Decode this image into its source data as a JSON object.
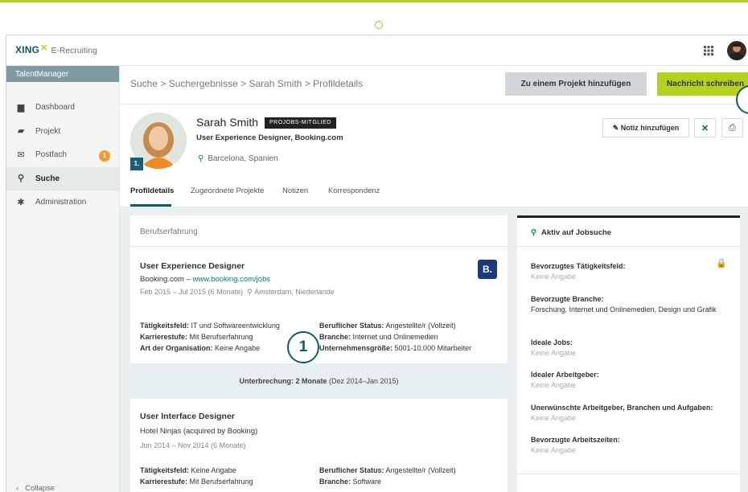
{
  "app": {
    "brand": "XING",
    "product": "E-Recruiting",
    "section": "TalentManager"
  },
  "nav": [
    {
      "label": "Dashboard",
      "icon": "dashboard-icon"
    },
    {
      "label": "Projekt",
      "icon": "folder-icon"
    },
    {
      "label": "Postfach",
      "icon": "mail-icon",
      "badge": "1"
    },
    {
      "label": "Suche",
      "icon": "search-icon",
      "active": true
    },
    {
      "label": "Administration",
      "icon": "gear-icon"
    }
  ],
  "collapse_label": "Collapse",
  "breadcrumb": "Suche > Suchergebnisse > Sarah Smith > Profildetails",
  "actions": {
    "add_project": "Zu einem Projekt hinzufügen",
    "message": "Nachricht schreiben",
    "note": "Notiz hinzufügen"
  },
  "profile": {
    "name": "Sarah Smith",
    "badge": "PROJOBS-MITGLIED",
    "headline": "User Experience Designer, Booking.com",
    "location": "Barcelona, Spanien",
    "rank": "1."
  },
  "tabs": [
    "Profildetails",
    "Zugeordnete Projekte",
    "Notizen",
    "Korrespondenz"
  ],
  "experience": {
    "section_title": "Berufserfahrung",
    "jobs": [
      {
        "title": "User Experience Designer",
        "company": "Booking.com",
        "sep": " – ",
        "link": "www.booking.com/jobs",
        "dates": "Feb 2015 – Jul 2015 (6 Monate)",
        "location": "Amsterdam, Niederlande",
        "logo": "B.",
        "left": [
          [
            "Tätigkeitsfeld:",
            "IT und Softwareentwicklung"
          ],
          [
            "Karrierestufe:",
            "Mit Berufserfahrung"
          ],
          [
            "Art der Organisation:",
            "Keine Angabe"
          ]
        ],
        "right": [
          [
            "Beruflicher Status:",
            "Angestellte/r (Vollzeit)"
          ],
          [
            "Branche:",
            "Internet und Onlinemedien"
          ],
          [
            "Unternehmensgröße:",
            "5001-10.000 Mitarbeiter"
          ]
        ]
      },
      {
        "title": "User Interface Designer",
        "company": "Hotel Ninjas (acquired by Booking)",
        "dates": "Jun 2014 – Nov 2014 (6 Monate)",
        "left": [
          [
            "Tätigkeitsfeld:",
            "Keine Angabe"
          ],
          [
            "Karrierestufe:",
            "Mit Berufserfahrung"
          ]
        ],
        "right": [
          [
            "Beruflicher Status:",
            "Angestellte/r (Vollzeit)"
          ],
          [
            "Branche:",
            "Software"
          ]
        ]
      }
    ],
    "gap": {
      "bold": "Unterbrechung: 2 Monate",
      "rest": " (Dez 2014–Jan 2015)"
    }
  },
  "callout": "1",
  "job_search": {
    "title": "Aktiv auf Jobsuche",
    "items": [
      {
        "key": "Bevorzugtes Tätigkeitsfeld:",
        "value": "Keine Angabe",
        "empty": true
      },
      {
        "key": "Bevorzugte Branche:",
        "value": "Forschung, Internet und Onlinemedien, Design und Grafik",
        "empty": false
      },
      {
        "key": "Ideale Jobs:",
        "value": "Keine Angabe",
        "empty": true
      },
      {
        "key": "Idealer Arbeitgeber:",
        "value": "Keine Angabe",
        "empty": true
      },
      {
        "key": "Unerwünschte Arbeitgeber, Branchen und Aufgaben:",
        "value": "Keine Angabe",
        "empty": true
      },
      {
        "key": "Bevorzugte Arbeitszeiten:",
        "value": "Keine Angabe",
        "empty": true
      }
    ]
  },
  "colors": {
    "brand_green": "#b6d01e",
    "brand_teal": "#0a5f61",
    "badge_orange": "#f39a32"
  }
}
